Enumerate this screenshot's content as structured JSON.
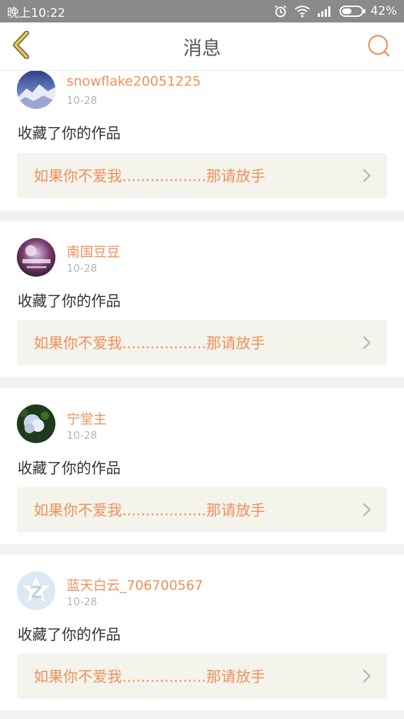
{
  "status_bar": {
    "time": "晚上10:22",
    "battery": "42%",
    "icons": [
      "alarm-icon",
      "wifi-icon",
      "signal-icon",
      "battery-icon"
    ]
  },
  "header": {
    "title": "消息",
    "back_icon": "chevron-left-icon",
    "search_icon": "search-icon"
  },
  "colors": {
    "accent": "#f0905a",
    "back_arrow": "#e7c83c",
    "card_bg": "#f4f3ec",
    "page_bg": "#f2f2f2",
    "status_bar_bg": "#8a8a8a"
  },
  "messages": [
    {
      "username": "snowflake20051225",
      "time": "10-28",
      "action": "收藏了你的作品",
      "work_title": "如果你不爱我..................那请放手"
    },
    {
      "username": "南国豆豆",
      "time": "10-28",
      "action": "收藏了你的作品",
      "work_title": "如果你不爱我..................那请放手"
    },
    {
      "username": "宁堂主",
      "time": "10-28",
      "action": "收藏了你的作品",
      "work_title": "如果你不爱我..................那请放手"
    },
    {
      "username": "蓝天白云_706700567",
      "time": "10-28",
      "action": "收藏了你的作品",
      "work_title": "如果你不爱我..................那请放手"
    }
  ]
}
